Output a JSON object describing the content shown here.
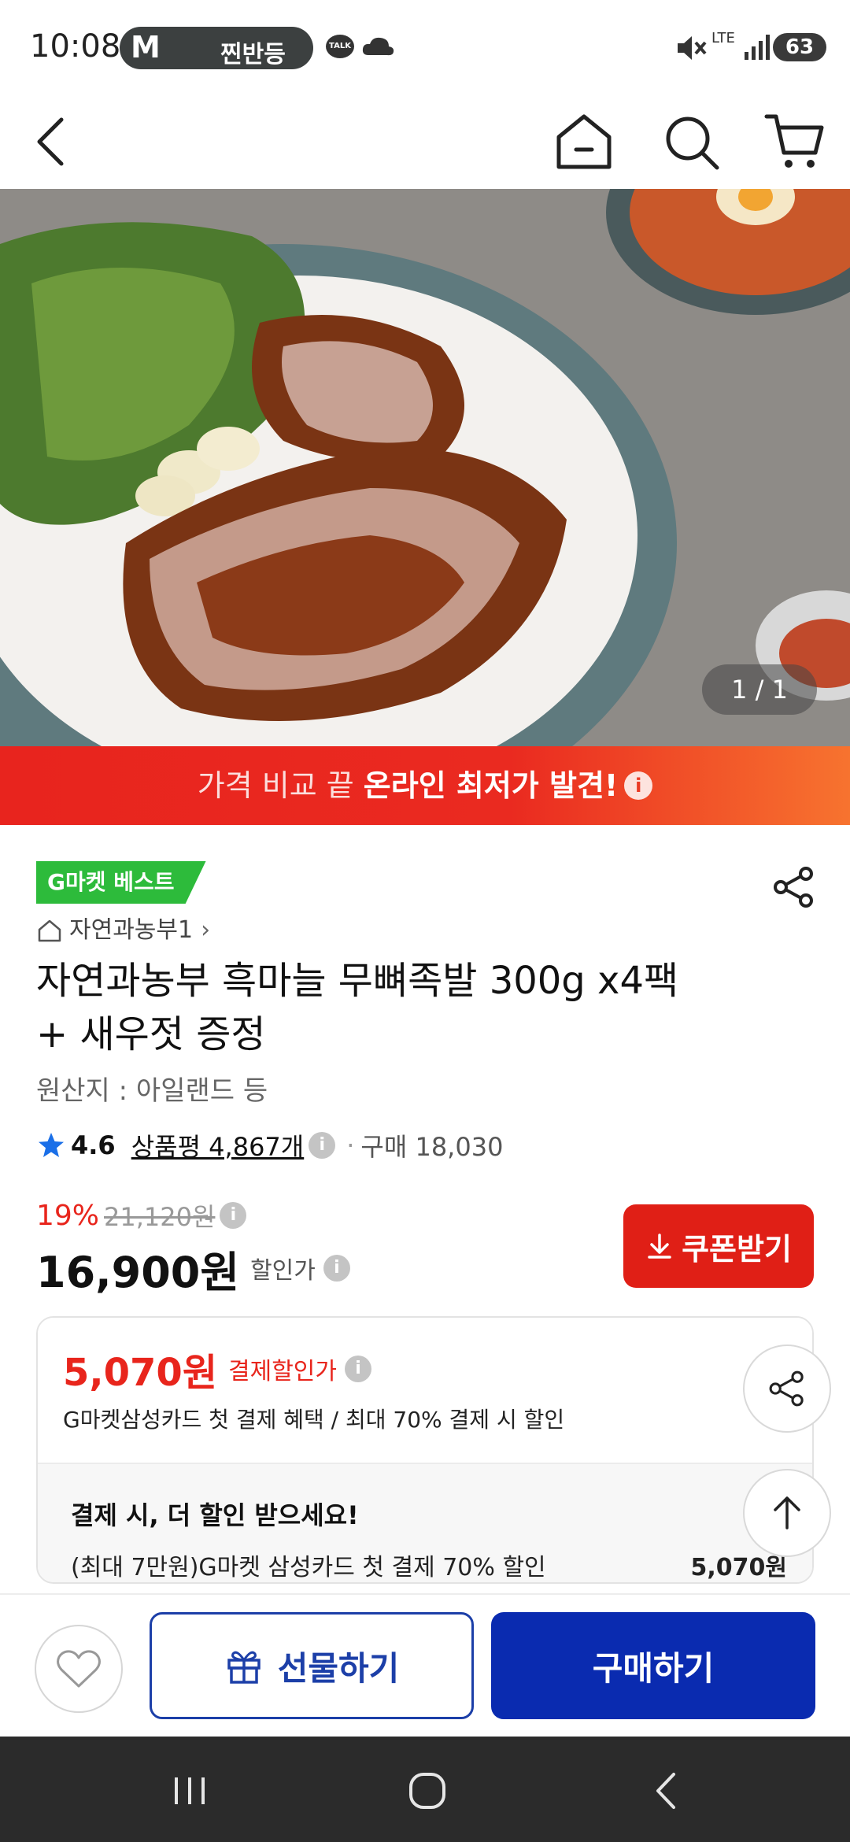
{
  "status_bar": {
    "time": "10:08",
    "notification_app": "M",
    "notification_text": "찐반등",
    "talk_label": "TALK",
    "network": "LTE",
    "battery": "63"
  },
  "hero": {
    "image_counter": "1 / 1"
  },
  "promo_banner": {
    "light_text": "가격 비교 끝 ",
    "bold_text": "온라인 최저가 발견!",
    "info_glyph": "i"
  },
  "product": {
    "badge": "G마켓 베스트",
    "seller": "자연과농부1",
    "seller_chevron": "›",
    "title_line1": "자연과농부 흑마늘 무뼈족발 300g x4팩",
    "title_line2": "+ 새우젓 증정",
    "origin": "원산지 : 아일랜드 등",
    "rating": "4.6",
    "review_label": "상품평 4,867개",
    "purchase_count": "구매 18,030",
    "discount_rate": "19%",
    "original_price": "21,120원",
    "sale_price": "16,900원",
    "sale_label": "할인가",
    "coupon_button": "쿠폰받기"
  },
  "card_discount": {
    "price": "5,070원",
    "label": "결제할인가",
    "description": "G마켓삼성카드 첫 결제 혜택 / 최대 70% 결제 시 할인",
    "promo_title": "결제 시, 더 할인 받으세요!",
    "promo_row_text": "(최대 7만원)G마켓 삼성카드 첫 결제 70% 할인",
    "promo_row_amount": "5,070원"
  },
  "action_bar": {
    "gift_button": "선물하기",
    "buy_button": "구매하기"
  },
  "colors": {
    "accent_red": "#e8251c",
    "buy_blue": "#0a2bb0",
    "badge_green": "#2dbb3b"
  }
}
